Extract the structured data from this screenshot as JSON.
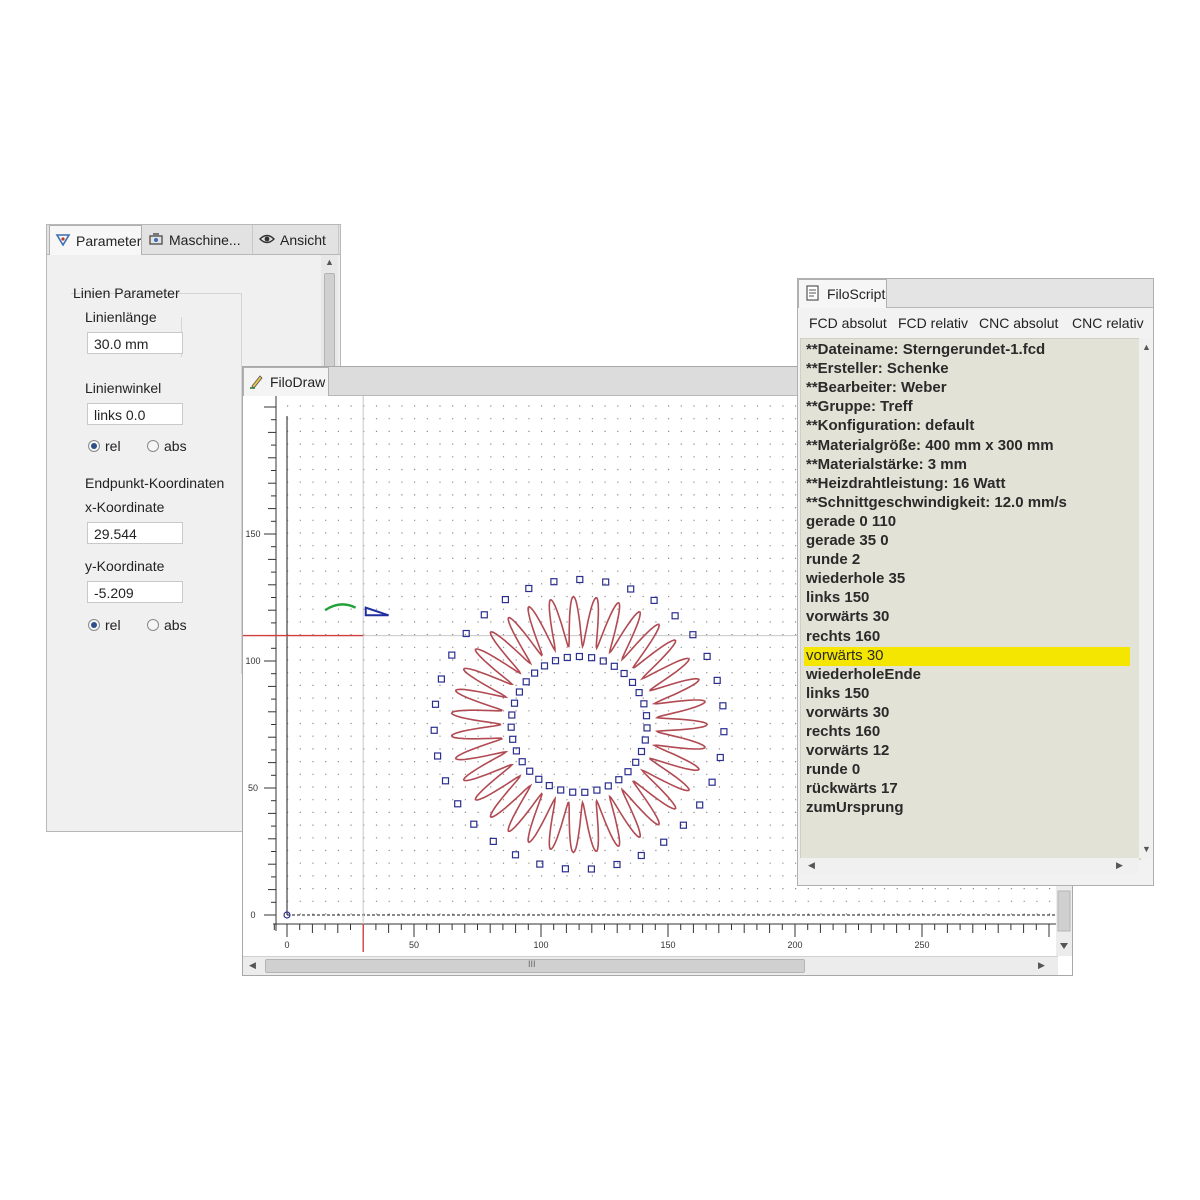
{
  "parameter_panel": {
    "tabs": [
      {
        "label": "Parameter",
        "icon": "parameter-icon"
      },
      {
        "label": "Maschine...",
        "icon": "machine-icon"
      },
      {
        "label": "Ansicht",
        "icon": "eye-icon"
      }
    ],
    "group_title": "Linien Parameter",
    "line_length": {
      "label": "Linienlänge",
      "value": "30.0 mm"
    },
    "line_angle": {
      "label": "Linienwinkel",
      "value": "links 0.0",
      "mode_rel": "rel",
      "mode_abs": "abs",
      "selected": "rel"
    },
    "endpoint": {
      "title": "Endpunkt-Koordinaten",
      "x_label": "x-Koordinate",
      "x_value": "29.544",
      "y_label": "y-Koordinate",
      "y_value": "-5.209",
      "mode_rel": "rel",
      "mode_abs": "abs",
      "selected": "rel"
    }
  },
  "draw_window": {
    "tab_label": "FiloDraw",
    "x_ticks": [
      "0",
      "50",
      "100",
      "150",
      "200",
      "250"
    ],
    "y_ticks": [
      "150",
      "100",
      "50",
      "0"
    ],
    "scroll_grip": "III",
    "colors": {
      "path": "#b14a52",
      "markers": "#2b2f8f",
      "active_segment": "#22a13a",
      "cursor": "#1f2fa0",
      "origin_line": "#d04040",
      "grid": "#8a8a8a"
    }
  },
  "script_window": {
    "tab_label": "FiloScript",
    "format_tabs": [
      "FCD absolut",
      "FCD relativ",
      "CNC absolut",
      "CNC relativ"
    ],
    "lines": [
      "**Dateiname: Sterngerundet-1.fcd",
      "**Ersteller: Schenke",
      "**Bearbeiter: Weber",
      "**Gruppe: Treff",
      "**Konfiguration: default",
      "**Materialgröße: 400 mm x 300 mm",
      "**Materialstärke: 3 mm",
      "**Heizdrahtleistung: 16 Watt",
      "**Schnittgeschwindigkeit: 12.0 mm/s",
      "gerade 0 110",
      "gerade 35 0",
      "runde 2",
      "wiederhole 35",
      "links 150",
      "vorwärts 30",
      "rechts 160",
      "vorwärts 30",
      "wiederholeEnde",
      "links 150",
      "vorwärts 30",
      "rechts 160",
      "vorwärts 12",
      "runde 0",
      "rückwärts 17",
      "zumUrsprung"
    ],
    "highlighted_line": "vorwärts 30",
    "highlight_color": "#f4e600"
  }
}
